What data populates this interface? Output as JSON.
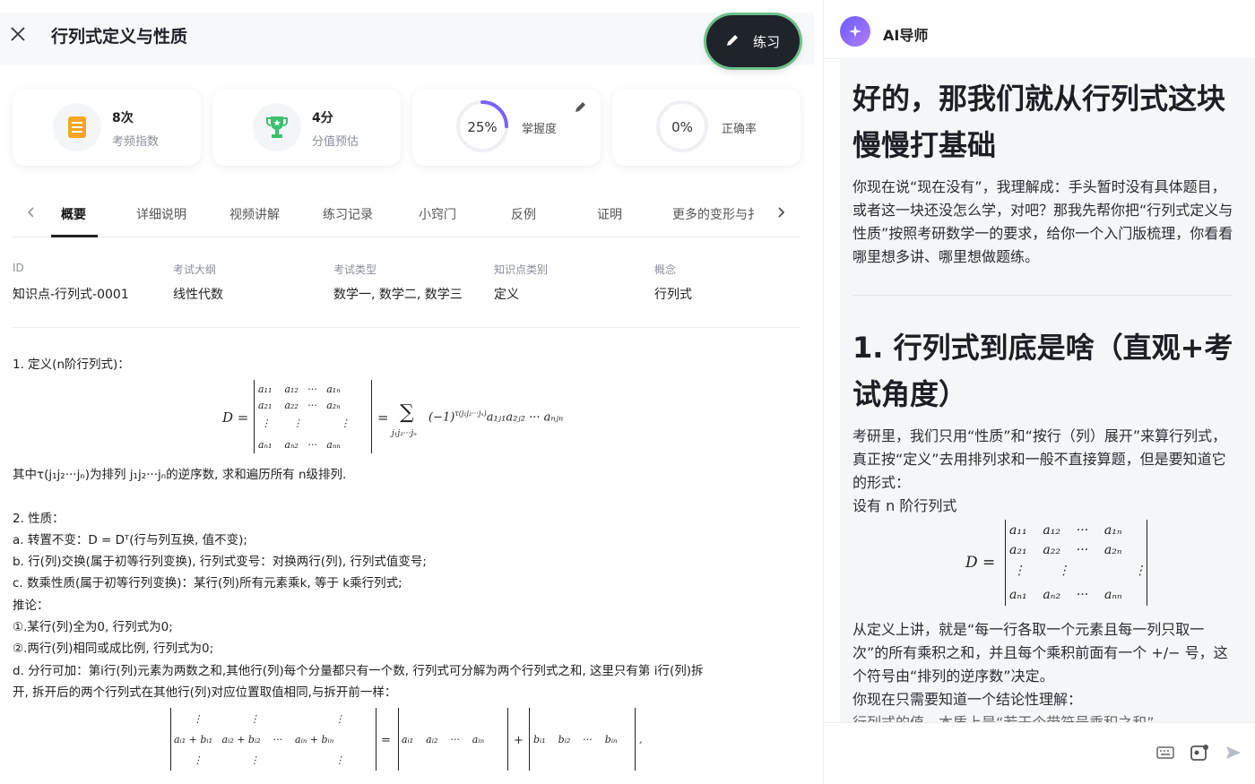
{
  "header": {
    "title": "行列式定义与性质",
    "practice_label": "练习"
  },
  "stats": [
    {
      "value": "8次",
      "label": "考频指数",
      "icon": "document-list-icon",
      "color": "#f5a623"
    },
    {
      "value": "4分",
      "label": "分值预估",
      "icon": "trophy-icon",
      "color": "#3cbf6e"
    },
    {
      "value": "25%",
      "label": "掌握度",
      "progress": 0.25,
      "color": "#7b61ff"
    },
    {
      "value": "0%",
      "label": "正确率",
      "progress": 0
    }
  ],
  "tabs": [
    "概要",
    "详细说明",
    "视频讲解",
    "练习记录",
    "小窍门",
    "反例",
    "证明",
    "更多的变形与扌"
  ],
  "meta": [
    {
      "key": "ID",
      "value": "知识点-行列式-0001"
    },
    {
      "key": "考试大纲",
      "value": "线性代数"
    },
    {
      "key": "考试类型",
      "value": "数学一, 数学二, 数学三"
    },
    {
      "key": "知识点类别",
      "value": "定义"
    },
    {
      "key": "概念",
      "value": "行列式"
    }
  ],
  "content": {
    "def_title": "1. 定义(n阶行列式)：",
    "def_note": "其中τ(j₁j₂···jₙ)为排列 j₁j₂···jₙ的逆序数, 求和遍历所有 n级排列.",
    "prop_title": "2. 性质：",
    "prop_a": "a. 转置不变：D = Dᵀ(行与列互换, 值不变);",
    "prop_b": "b. 行(列)交换(属于初等行列变换), 行列式变号：对换两行(列), 行列式值变号;",
    "prop_c": "c. 数乘性质(属于初等行列变换)：某行(列)所有元素乘k, 等于 k乘行列式;",
    "corollary": "推论：",
    "cor_1": "①.某行(列)全为0, 行列式为0;",
    "cor_2": "②.两行(列)相同或成比例, 行列式为0;",
    "prop_d1": "d. 分行可加：第i行(列)元素为两数之和,其他行(列)每个分量都只有一个数, 行列式可分解为两个行列式之和, 这里只有第 i行(列)拆",
    "prop_d2": "开, 拆开后的两个行列式在其他行(列)对应位置取值相同,与拆开前一样："
  },
  "assistant": {
    "name": "AI导师",
    "heading1": "好的，那我们就从行列式这块慢慢打基础",
    "para1": "你现在说“现在没有”，我理解成：手头暂时没有具体题目，或者这一块还没怎么学，对吧？那我先帮你把“行列式定义与性质”按照考研数学一的要求，给你一个入门版梳理，你看看哪里想多讲、哪里想做题练。",
    "heading2": "1. 行列式到底是啥（直观+考试角度）",
    "para2": "考研里，我们只用“性质”和“按行（列）展开”来算行列式，真正按“定义”去用排列求和一般不直接算题，但是要知道它的形式：",
    "para2b": "设有 n 阶行列式",
    "para3": "从定义上讲，就是“每一行各取一个元素且每一列只取一次”的所有乘积之和，并且每个乘积前面有一个 +/− 号，这个符号由“排列的逆序数”决定。",
    "para4": "你现在只需要知道一个结论性理解：",
    "para5_cut": "行列式的值，本质上是“若干个带符号乘积之和”"
  }
}
